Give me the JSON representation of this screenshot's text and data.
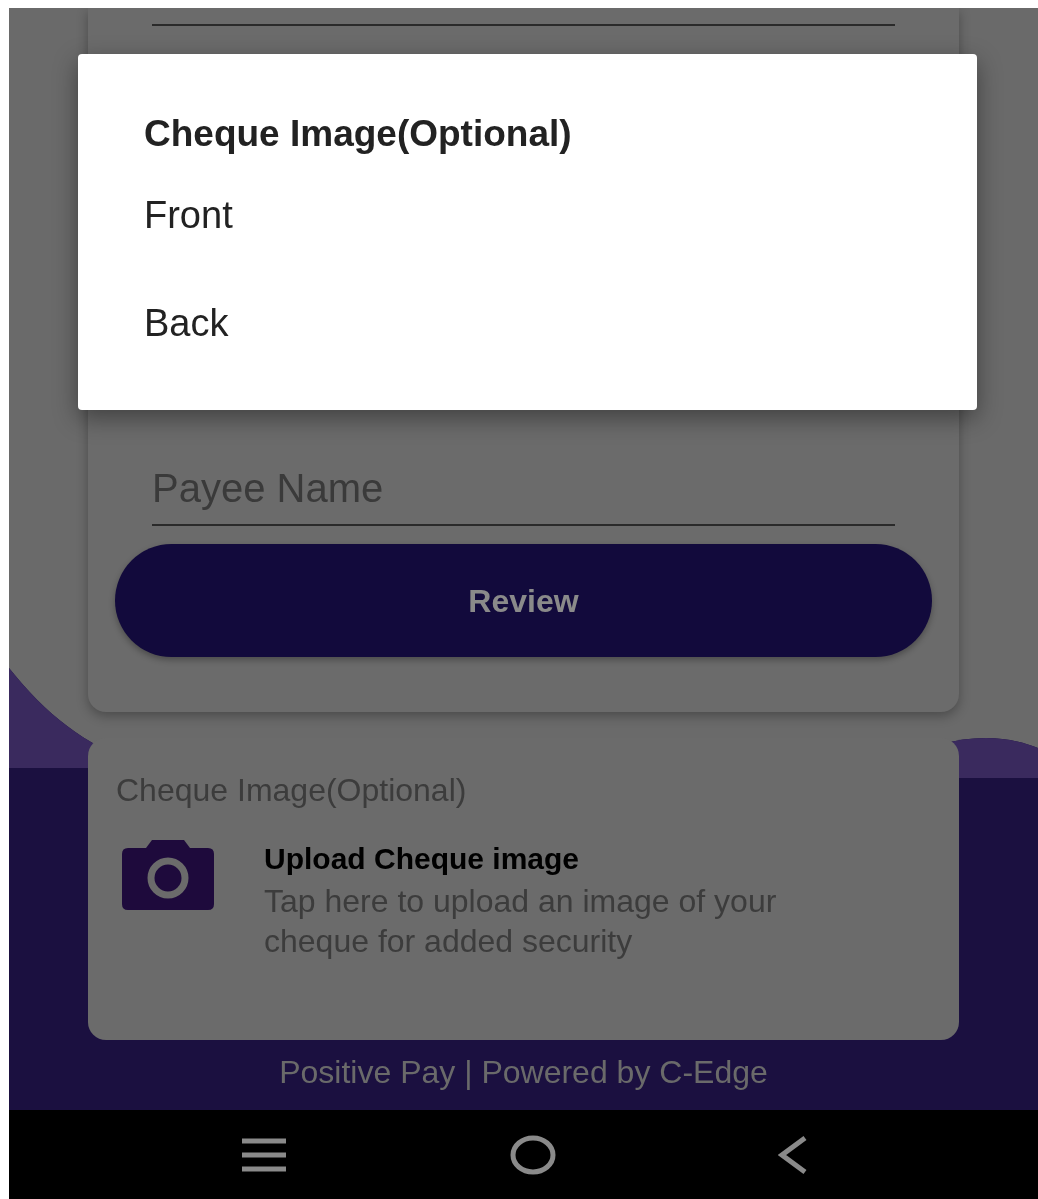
{
  "dialog": {
    "title": "Cheque Image(Optional)",
    "options": [
      {
        "label": "Front"
      },
      {
        "label": "Back"
      }
    ]
  },
  "form": {
    "payee_placeholder": "Payee Name",
    "review_button": "Review"
  },
  "upload_card": {
    "label": "Cheque Image(Optional)",
    "title": "Upload Cheque image",
    "description": "Tap here to upload an image of your cheque for added security"
  },
  "footer": "Positive Pay | Powered by C-Edge"
}
